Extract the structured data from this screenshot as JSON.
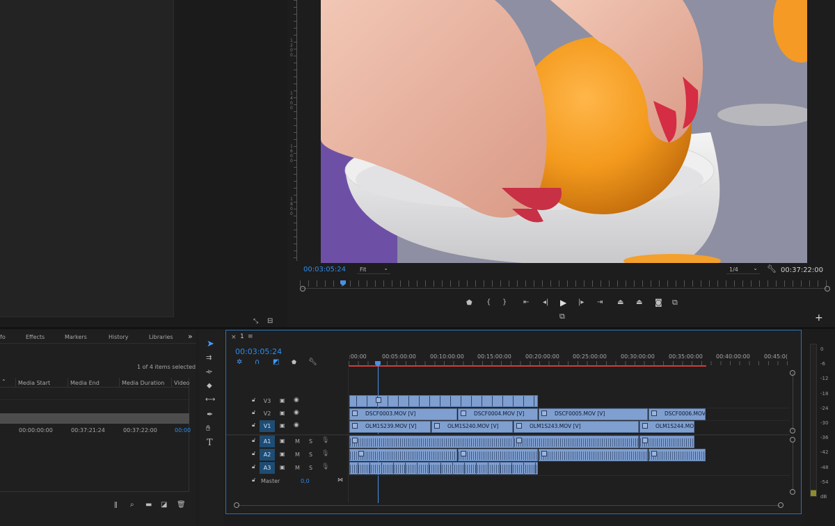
{
  "program": {
    "timecode_left": "00:03:05:24",
    "fit": "Fit",
    "resolution": "1/4",
    "timecode_right": "00:37:22:00",
    "ruler_left": [
      "1",
      "2",
      "0",
      "0",
      "1",
      "4",
      "0",
      "0",
      "1",
      "6",
      "0",
      "0",
      "1",
      "8",
      "0",
      "0",
      "1",
      "1"
    ]
  },
  "project": {
    "tabs": [
      "fo",
      "Effects",
      "Markers",
      "History",
      "Libraries"
    ],
    "more": "»",
    "selection": "1 of 4 items selected",
    "columns": [
      "Media Start",
      "Media End",
      "Media Duration",
      "Video"
    ],
    "row": {
      "start": "00:00:00:00",
      "end": "00:37:21:24",
      "duration": "00:37:22:00",
      "video": "00:00"
    }
  },
  "timeline": {
    "close": "×",
    "seq_name": "1",
    "menu": "≡",
    "timecode": "00:03:05:24",
    "ruler": [
      ":00:00",
      "00:05:00:00",
      "00:10:00:00",
      "00:15:00:00",
      "00:20:00:00",
      "00:25:00:00",
      "00:30:00:00",
      "00:35:00:00",
      "00:40:00:00",
      "00:45:0("
    ],
    "tracks": {
      "v3": "V3",
      "v2": "V2",
      "v1": "V1",
      "a1": "A1",
      "a2": "A2",
      "a3": "A3",
      "master": "Master",
      "master_val": "0,0"
    },
    "clips_v2": [
      "DSCF0003.MOV [V]",
      "DSCF0004.MOV [V]",
      "DSCF0005.MOV [V]",
      "DSCF0006.MOV"
    ],
    "clips_v1": [
      "OLM1S239.MOV [V]",
      "OLM1S240.MOV [V]",
      "OLM1S243.MOV [V]",
      "OLM1S244.MOV"
    ],
    "ms": "M",
    "ss": "S"
  },
  "meter": {
    "scale": [
      "0",
      "-6",
      "-12",
      "-18",
      "-24",
      "-30",
      "-36",
      "-42",
      "-48",
      "-54",
      "dB"
    ]
  },
  "colors": {
    "accent": "#2d8ceb",
    "clip": "#7f9fd0",
    "playhead": "#4a90e2",
    "workarea": "#d23b3b"
  }
}
